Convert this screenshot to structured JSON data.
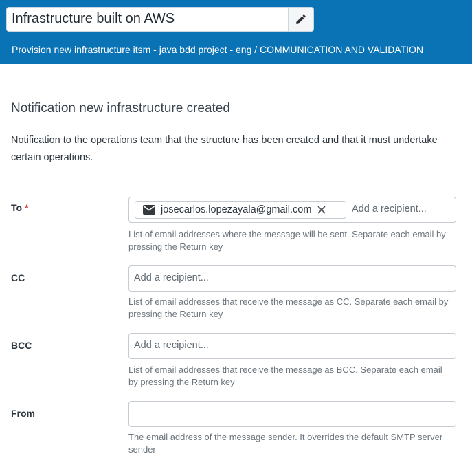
{
  "header": {
    "title": "Infrastructure built on AWS",
    "breadcrumb": "Provision new infrastructure itsm - java bdd project - eng / COMMUNICATION AND VALIDATION",
    "edit_icon": "pencil-icon",
    "background_color": "#0a73b5"
  },
  "section": {
    "title": "Notification new infrastructure created",
    "description": "Notification to the operations team that the structure has been created and that it must undertake certain operations."
  },
  "fields": {
    "to": {
      "label": "To",
      "required_marker": "*",
      "recipients": [
        {
          "email": "josecarlos.lopezayala@gmail.com",
          "icon": "envelope-icon",
          "remove_icon": "close-icon"
        }
      ],
      "placeholder": "Add a recipient...",
      "help": "List of email addresses where the message will be sent. Separate each email by pressing the Return key"
    },
    "cc": {
      "label": "CC",
      "placeholder": "Add a recipient...",
      "help": "List of email addresses that receive the message as CC. Separate each email by pressing the Return key"
    },
    "bcc": {
      "label": "BCC",
      "placeholder": "Add a recipient...",
      "help": "List of email addresses that receive the message as BCC. Separate each email by pressing the Return key"
    },
    "from": {
      "label": "From",
      "value": "",
      "help": "The email address of the message sender. It overrides the default SMTP server sender"
    }
  }
}
